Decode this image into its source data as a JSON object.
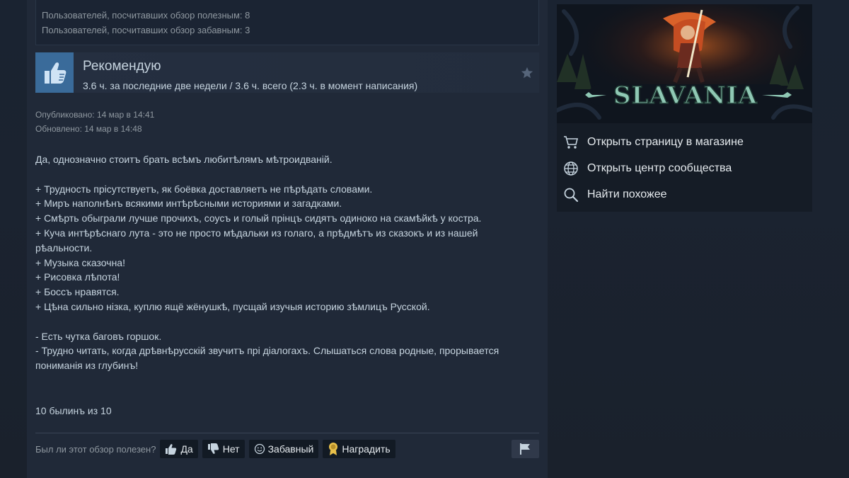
{
  "helpful": {
    "useful_line": "Пользователей, посчитавших обзор полезным: 8",
    "funny_line": "Пользователей, посчитавших обзор забавным: 3"
  },
  "review": {
    "verdict": "Рекомендую",
    "hours": "3.6 ч. за последние две недели / 3.6 ч. всего (2.3 ч. в момент написания)",
    "published": "Опубликовано: 14 мар в 14:41",
    "updated": "Обновлено: 14 мар в 14:48",
    "body": [
      "Да, однозначно стоитъ брать всѣмъ любитѣлямъ мѣтроидваній.",
      "",
      "+ Трудность прісутствуетъ, як боёвка доставляетъ не пѣрѣдать словами.",
      "+ Миръ наполнѣнъ всякими интѣрѣсными историями и загадками.",
      "+ Смѣрть обыграли лучше прочихъ, соусъ и голый прінцъ сидятъ одиноко на скамѣйкѣ у костра.",
      "+ Куча интѣрѣснаго лута - это не просто мѣдальки из голаго, а прѣдмѣтъ из сказокъ и из нашей рѣальности.",
      "+ Музыка сказочна!",
      "+ Рисовка лѣпота!",
      "+ Боссъ нравятся.",
      "+ Цѣна сильно нізка, куплю ящё жёнушкѣ, пусщай изучыя историю зѣмлицъ Русской.",
      "",
      "- Есть чутка баговъ горшок.",
      "- Трудно читать, когда дрѣвнѣрусскій звучитъ прі діалогахъ. Слышаться слова родные, прорывается пониманія из глубинъ!",
      "",
      "10 былинъ из 10"
    ]
  },
  "footer": {
    "question": "Был ли этот обзор полезен?",
    "yes": "Да",
    "no": "Нет",
    "funny": "Забавный",
    "award": "Наградить"
  },
  "game": {
    "logo_text": "SLAVANIA",
    "links": [
      {
        "label": "Открыть страницу в магазине",
        "icon": "cart-icon"
      },
      {
        "label": "Открыть центр сообщества",
        "icon": "globe-icon"
      },
      {
        "label": "Найти похожее",
        "icon": "search-icon"
      }
    ]
  }
}
